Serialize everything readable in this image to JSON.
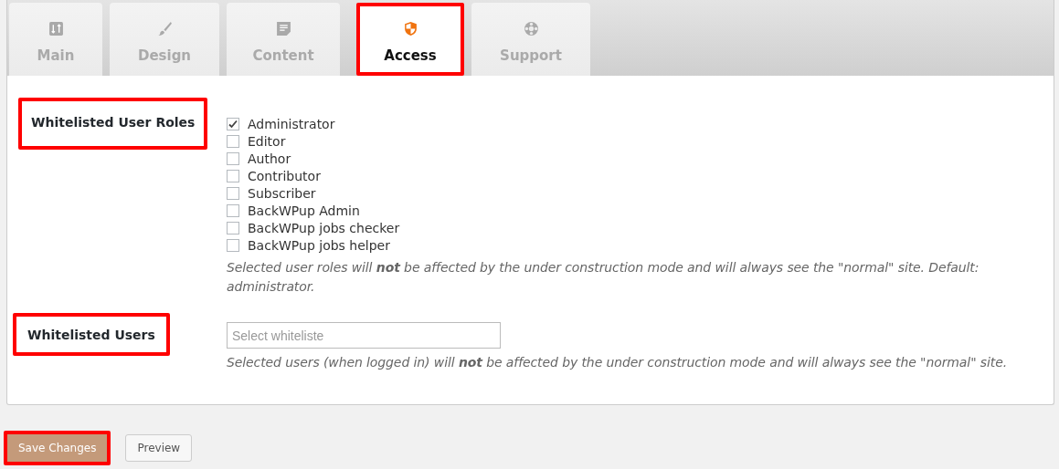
{
  "tabs": [
    {
      "label": "Main",
      "selected": false,
      "highlighted": false
    },
    {
      "label": "Design",
      "selected": false,
      "highlighted": false
    },
    {
      "label": "Content",
      "selected": false,
      "highlighted": false
    },
    {
      "label": "Access",
      "selected": true,
      "highlighted": true
    },
    {
      "label": "Support",
      "selected": false,
      "highlighted": false
    }
  ],
  "roles_section": {
    "label": "Whitelisted User Roles",
    "highlighted": true,
    "roles": [
      {
        "label": "Administrator",
        "checked": true
      },
      {
        "label": "Editor",
        "checked": false
      },
      {
        "label": "Author",
        "checked": false
      },
      {
        "label": "Contributor",
        "checked": false
      },
      {
        "label": "Subscriber",
        "checked": false
      },
      {
        "label": "BackWPup Admin",
        "checked": false
      },
      {
        "label": "BackWPup jobs checker",
        "checked": false
      },
      {
        "label": "BackWPup jobs helper",
        "checked": false
      }
    ],
    "description": "Selected user roles will **not** be affected by the under construction mode and will always see the \"normal\" site. Default: administrator."
  },
  "users_section": {
    "label": "Whitelisted Users",
    "highlighted": true,
    "placeholder": "Select whiteliste",
    "description": "Selected users (when logged in) will **not** be affected by the under construction mode and will always see the \"normal\" site."
  },
  "buttons": [
    {
      "label": "Save Changes",
      "kind": "primary",
      "highlighted": true
    },
    {
      "label": "Preview",
      "kind": "secondary",
      "highlighted": false
    }
  ]
}
